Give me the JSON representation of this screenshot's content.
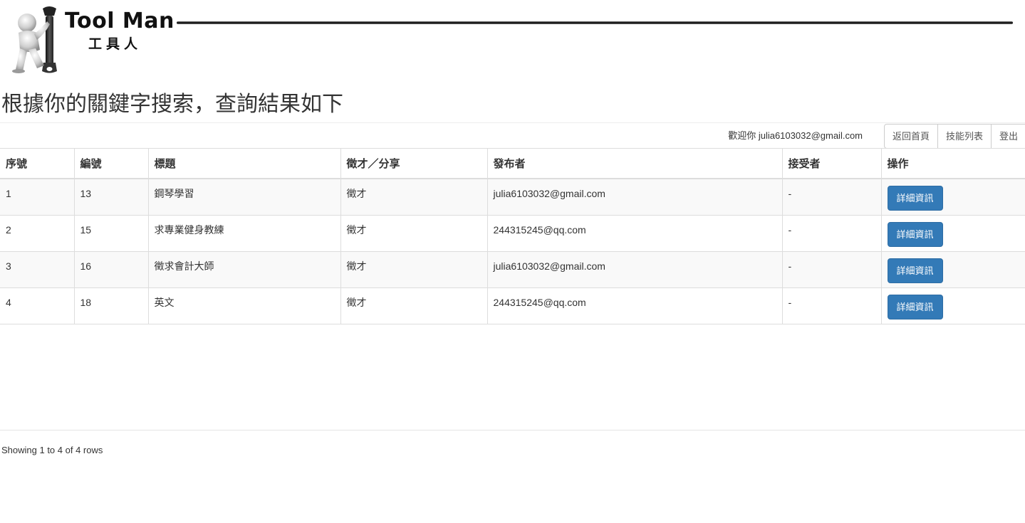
{
  "header": {
    "brand_title": "Tool Man",
    "brand_subtitle": "工具人",
    "logo_icon": "wrench-figure-icon"
  },
  "page": {
    "heading": "根據你的關鍵字搜索，查詢結果如下"
  },
  "top_bar": {
    "welcome": "歡迎你 julia6103032@gmail.com",
    "buttons": [
      "返回首頁",
      "技能列表",
      "登出"
    ]
  },
  "table": {
    "columns": [
      "序號",
      "編號",
      "標題",
      "徵才／分享",
      "發布者",
      "接受者",
      "操作"
    ],
    "rows": [
      {
        "index": "1",
        "id": "13",
        "title": "鋼琴學習",
        "type": "徵才",
        "publisher": "julia6103032@gmail.com",
        "receiver": "-",
        "action": "詳細資訊"
      },
      {
        "index": "2",
        "id": "15",
        "title": "求專業健身教練",
        "type": "徵才",
        "publisher": "244315245@qq.com",
        "receiver": "-",
        "action": "詳細資訊"
      },
      {
        "index": "3",
        "id": "16",
        "title": "徵求會計大師",
        "type": "徵才",
        "publisher": "julia6103032@gmail.com",
        "receiver": "-",
        "action": "詳細資訊"
      },
      {
        "index": "4",
        "id": "18",
        "title": "英文",
        "type": "徵才",
        "publisher": "244315245@qq.com",
        "receiver": "-",
        "action": "詳細資訊"
      }
    ]
  },
  "footer": {
    "pagination_info": "Showing 1 to 4 of 4 rows"
  },
  "colors": {
    "primary": "#337ab7",
    "striped_row": "#f9f9f9",
    "border": "#dddddd"
  }
}
